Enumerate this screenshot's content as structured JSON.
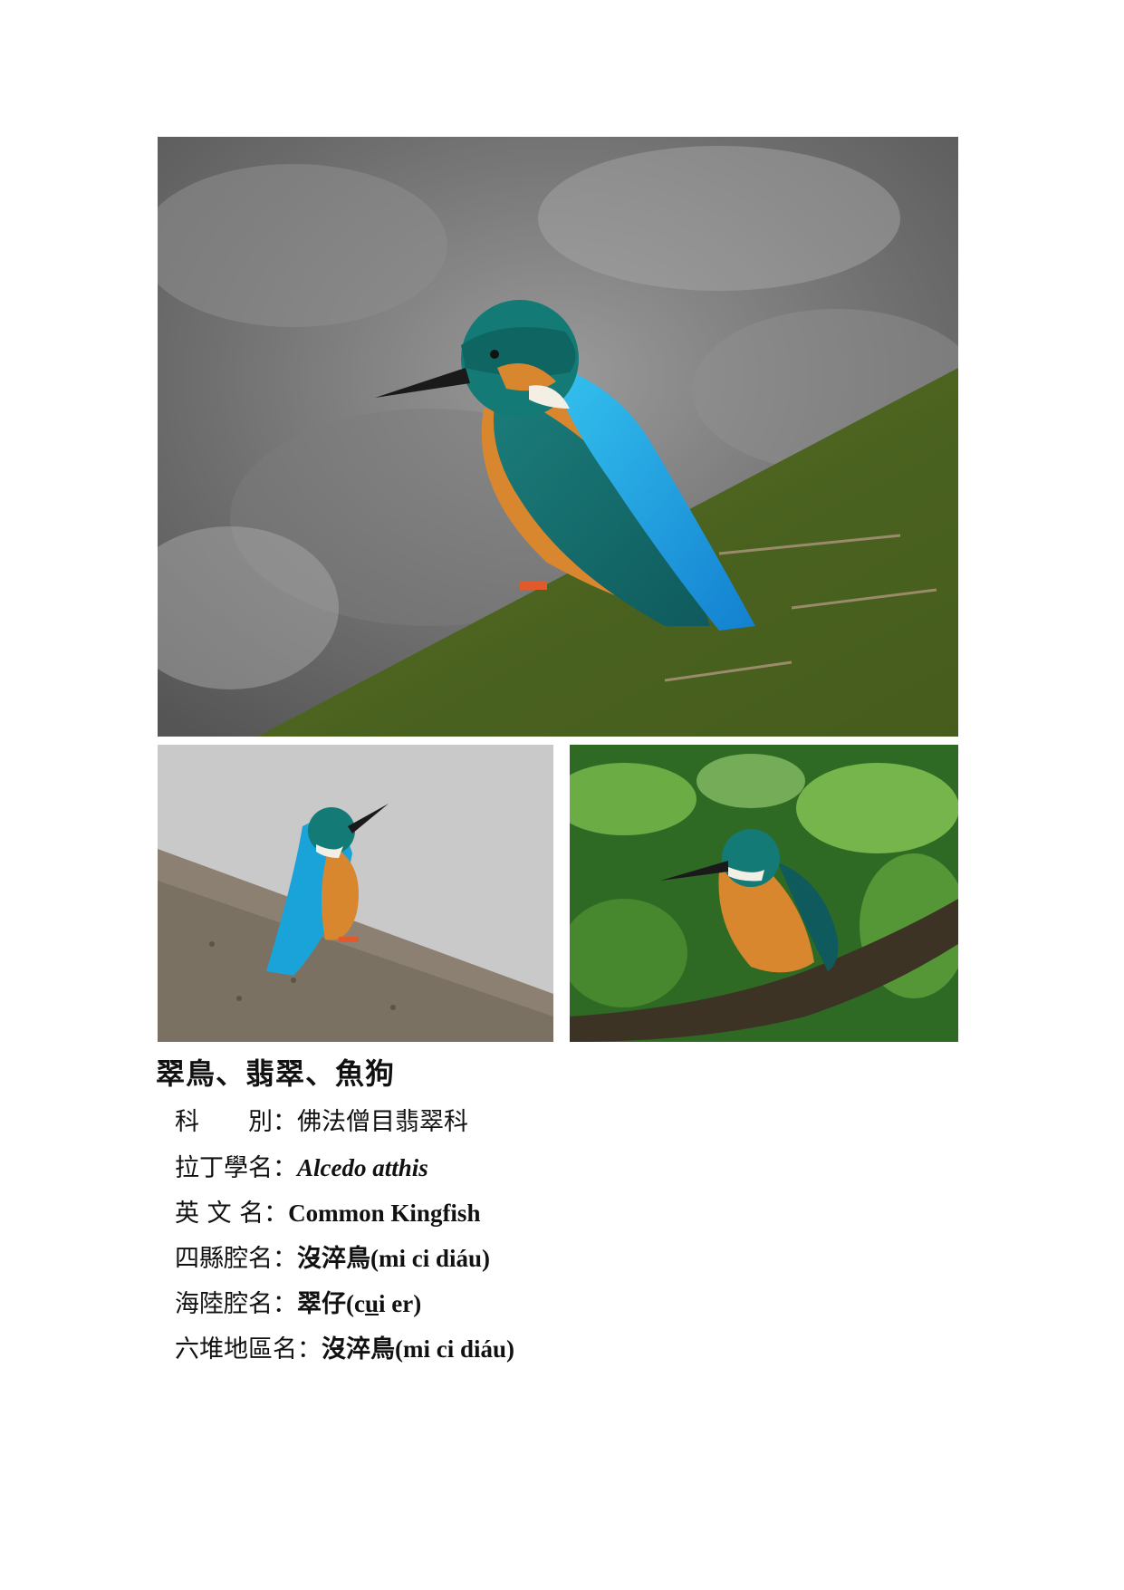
{
  "title": "翠鳥、翡翠、魚狗",
  "rows": [
    {
      "label": "科　　別",
      "value": "佛法僧目翡翠科"
    },
    {
      "label": "拉丁學名",
      "value": "Alcedo atthis"
    },
    {
      "label": "英 文 名",
      "value": "Common Kingfish"
    },
    {
      "label": "四縣腔名",
      "value": "沒淬鳥(mi ci diáu)"
    },
    {
      "label": "海陸腔名",
      "value_prefix": "翠仔(c",
      "value_under": "u",
      "value_suffix": "i er)"
    },
    {
      "label": "六堆地區名",
      "value": "沒淬鳥(mi ci diáu)"
    }
  ],
  "separator": "：",
  "colors": {
    "kingfisher_blue": "#1aa3d9",
    "kingfisher_orange": "#d8872e",
    "moss": "#4f6a1f"
  }
}
